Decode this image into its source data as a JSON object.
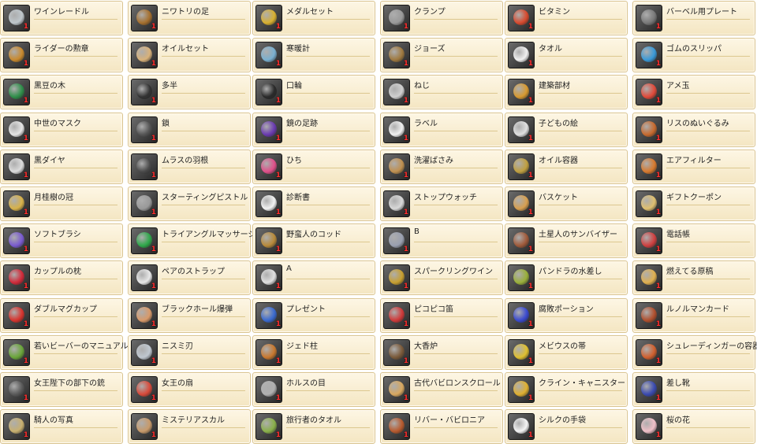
{
  "columns": [
    {
      "items": [
        {
          "name": "ワインレードル",
          "icon": "ladle-icon",
          "color": "#bfc7cc",
          "count": "1"
        },
        {
          "name": "ライダーの勲章",
          "icon": "medal-icon",
          "color": "#c98a2e",
          "count": "1"
        },
        {
          "name": "黒豆の木",
          "icon": "plant-icon",
          "color": "#2f8f4a",
          "count": "1"
        },
        {
          "name": "中世のマスク",
          "icon": "mask-icon",
          "color": "#e6e6e6",
          "count": "1"
        },
        {
          "name": "黒ダイヤ",
          "icon": "gem-icon",
          "color": "#dcdcdc",
          "count": "1"
        },
        {
          "name": "月桂樹の冠",
          "icon": "laurel-icon",
          "color": "#d8b24a",
          "count": "1"
        },
        {
          "name": "ソフトブラシ",
          "icon": "brush-icon",
          "color": "#7a5bd0",
          "count": "1"
        },
        {
          "name": "カップルの枕",
          "icon": "pillow-icon",
          "color": "#d22a3a",
          "count": "1"
        },
        {
          "name": "ダブルマグカップ",
          "icon": "mug-icon",
          "color": "#d8342e",
          "count": "1"
        },
        {
          "name": "若いビーバーのマニュアル",
          "icon": "book-icon",
          "color": "#6aa63a",
          "count": "1"
        },
        {
          "name": "女王陛下の部下の銃",
          "icon": "gun-icon",
          "color": "#5a5a5a",
          "count": "1"
        },
        {
          "name": "騎人の写真",
          "icon": "photo-icon",
          "color": "#c8b070",
          "count": "1"
        }
      ]
    },
    {
      "items": [
        {
          "name": "ニワトリの足",
          "icon": "claw-icon",
          "color": "#a6702e",
          "count": "1"
        },
        {
          "name": "オイルセット",
          "icon": "oil-set-icon",
          "color": "#d9b27a",
          "count": "1"
        },
        {
          "name": "多半",
          "icon": "rifle-icon",
          "color": "#333333",
          "count": "1"
        },
        {
          "name": "鎖",
          "icon": "chain-icon",
          "color": "#555555",
          "count": "1"
        },
        {
          "name": "ムラスの羽根",
          "icon": "feather-icon",
          "color": "#4a4a4a",
          "count": "1"
        },
        {
          "name": "スターティングピストル",
          "icon": "pistol-icon",
          "color": "#9a9a9a",
          "count": "1"
        },
        {
          "name": "トライアングルマッサージ",
          "icon": "massager-icon",
          "color": "#2ea84a",
          "count": "1"
        },
        {
          "name": "ペアのストラップ",
          "icon": "strap-icon",
          "color": "#e8e8e8",
          "count": "1"
        },
        {
          "name": "ブラックホール爆弾",
          "icon": "bomb-icon",
          "color": "#d99a6a",
          "count": "1"
        },
        {
          "name": "ニスミ刃",
          "icon": "blade-icon",
          "color": "#c0c8d0",
          "count": "1"
        },
        {
          "name": "女王の扇",
          "icon": "fan-icon",
          "color": "#d84a3a",
          "count": "1"
        },
        {
          "name": "ミステリアスカル",
          "icon": "skull-icon",
          "color": "#c89a6a",
          "count": "1"
        }
      ]
    },
    {
      "items": [
        {
          "name": "メダルセット",
          "icon": "medal-set-icon",
          "color": "#d8b030",
          "count": "1"
        },
        {
          "name": "寒暖計",
          "icon": "thermometer-icon",
          "color": "#7ab0d0",
          "count": "1"
        },
        {
          "name": "口輪",
          "icon": "muzzle-icon",
          "color": "#2a2a2a",
          "count": "1"
        },
        {
          "name": "鏡の足跡",
          "icon": "footprint-icon",
          "color": "#6a3ab0",
          "count": "1"
        },
        {
          "name": "ひち",
          "icon": "ribbon-icon",
          "color": "#e0508a",
          "count": "1"
        },
        {
          "name": "診断書",
          "icon": "document-icon",
          "color": "#f2f2f2",
          "count": "1"
        },
        {
          "name": "野蛮人のコッド",
          "icon": "item-icon",
          "color": "#b88a3a",
          "count": "1"
        },
        {
          "name": "A",
          "icon": "letter-a-icon",
          "color": "#e0e0e0",
          "count": "1"
        },
        {
          "name": "プレゼント",
          "icon": "present-icon",
          "color": "#3a6ad0",
          "count": "1"
        },
        {
          "name": "ジェド柱",
          "icon": "pillar-icon",
          "color": "#c8782e",
          "count": "1"
        },
        {
          "name": "ホルスの目",
          "icon": "eye-icon",
          "color": "#b0b0b0",
          "count": "1"
        },
        {
          "name": "旅行者のタオル",
          "icon": "towel-icon",
          "color": "#8ab04a",
          "count": "1"
        }
      ]
    },
    {
      "items": [
        {
          "name": "クランプ",
          "icon": "clamp-icon",
          "color": "#9a9a9a",
          "count": "1"
        },
        {
          "name": "ジョーズ",
          "icon": "jaws-icon",
          "color": "#a07a40",
          "count": "1"
        },
        {
          "name": "ねじ",
          "icon": "screw-icon",
          "color": "#d0d0d0",
          "count": "1"
        },
        {
          "name": "ラベル",
          "icon": "label-icon",
          "color": "#f0f0f0",
          "count": "1"
        },
        {
          "name": "洗濯ばさみ",
          "icon": "clothespin-icon",
          "color": "#c09050",
          "count": "1"
        },
        {
          "name": "ストップウォッチ",
          "icon": "stopwatch-icon",
          "color": "#d8d8d8",
          "count": "1"
        },
        {
          "name": "B",
          "icon": "letter-b-icon",
          "color": "#9aa0b0",
          "count": "1"
        },
        {
          "name": "スパークリングワイン",
          "icon": "wine-icon",
          "color": "#c8a030",
          "count": "1"
        },
        {
          "name": "ピコピコ笛",
          "icon": "whistle-icon",
          "color": "#d03a3a",
          "count": "1"
        },
        {
          "name": "大香炉",
          "icon": "censer-icon",
          "color": "#7a5a3a",
          "count": "1"
        },
        {
          "name": "古代バビロンスクロール",
          "icon": "scroll-icon",
          "color": "#d8a860",
          "count": "1"
        },
        {
          "name": "リバー・バビロニア",
          "icon": "river-icon",
          "color": "#b85a2e",
          "count": "1"
        }
      ]
    },
    {
      "items": [
        {
          "name": "ビタミン",
          "icon": "vitamin-icon",
          "color": "#d84a2e",
          "count": "1"
        },
        {
          "name": "タオル",
          "icon": "towel-icon",
          "color": "#f0f0f0",
          "count": "1"
        },
        {
          "name": "建築部材",
          "icon": "materials-icon",
          "color": "#d89a30",
          "count": "1"
        },
        {
          "name": "子どもの絵",
          "icon": "drawing-icon",
          "color": "#e0e0e0",
          "count": "1"
        },
        {
          "name": "オイル容器",
          "icon": "oil-can-icon",
          "color": "#c0a040",
          "count": "1"
        },
        {
          "name": "バスケット",
          "icon": "basket-icon",
          "color": "#d8a050",
          "count": "1"
        },
        {
          "name": "土星人のサンバイザー",
          "icon": "visor-icon",
          "color": "#a05a3a",
          "count": "1"
        },
        {
          "name": "パンドラの水差し",
          "icon": "jug-icon",
          "color": "#9ab03a",
          "count": "1"
        },
        {
          "name": "腐敗ポーション",
          "icon": "potion-icon",
          "color": "#3a4ad0",
          "count": "1"
        },
        {
          "name": "メビウスの帯",
          "icon": "mobius-icon",
          "color": "#e0c030",
          "count": "1"
        },
        {
          "name": "クライン・キャニスター",
          "icon": "canister-icon",
          "color": "#e0b030",
          "count": "1"
        },
        {
          "name": "シルクの手袋",
          "icon": "glove-icon",
          "color": "#f4f4f4",
          "count": "1"
        }
      ]
    },
    {
      "items": [
        {
          "name": "バーベル用プレート",
          "icon": "plate-icon",
          "color": "#7a7a7a",
          "count": "1"
        },
        {
          "name": "ゴムのスリッパ",
          "icon": "slipper-icon",
          "color": "#3a9ad8",
          "count": "1"
        },
        {
          "name": "アメ玉",
          "icon": "candy-icon",
          "color": "#e04a3a",
          "count": "1"
        },
        {
          "name": "リスのぬいぐるみ",
          "icon": "squirrel-icon",
          "color": "#c86a2e",
          "count": "1"
        },
        {
          "name": "エアフィルター",
          "icon": "filter-icon",
          "color": "#d87a2e",
          "count": "1"
        },
        {
          "name": "ギフトクーポン",
          "icon": "coupon-icon",
          "color": "#e0c070",
          "count": "1"
        },
        {
          "name": "電話帳",
          "icon": "phonebook-icon",
          "color": "#d04040",
          "count": "1"
        },
        {
          "name": "燃えてる原稿",
          "icon": "manuscript-icon",
          "color": "#e0b050",
          "count": "1"
        },
        {
          "name": "ルノルマンカード",
          "icon": "cards-icon",
          "color": "#b0502e",
          "count": "1"
        },
        {
          "name": "シュレーディンガーの容器",
          "icon": "box-icon",
          "color": "#d0602e",
          "count": "1"
        },
        {
          "name": "差し靴",
          "icon": "shoe-icon",
          "color": "#3a4ab0",
          "count": "1"
        },
        {
          "name": "桜の花",
          "icon": "blossom-icon",
          "color": "#f0c0c8",
          "count": "1"
        }
      ]
    }
  ]
}
